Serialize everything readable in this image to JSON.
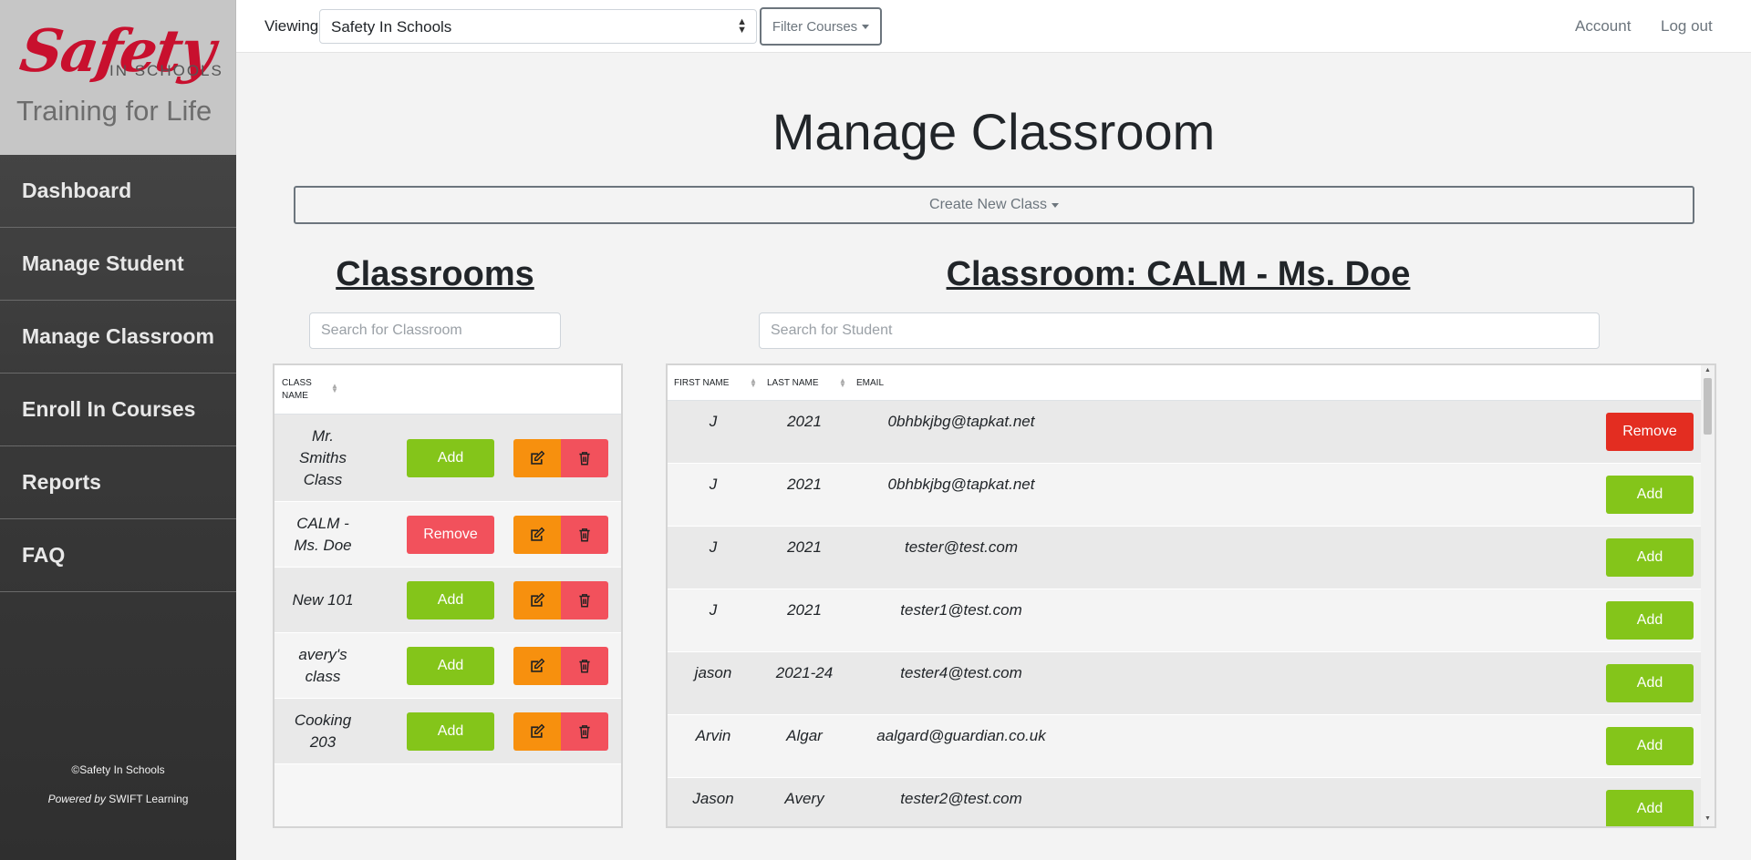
{
  "sidebar": {
    "logo_main": "Safety",
    "logo_sub": "IN SCHOOLS",
    "logo_tagline": "Training for Life",
    "items": [
      {
        "label": "Dashboard"
      },
      {
        "label": "Manage Student"
      },
      {
        "label": "Manage Classroom"
      },
      {
        "label": "Enroll In Courses"
      },
      {
        "label": "Reports"
      },
      {
        "label": "FAQ"
      }
    ],
    "copyright": "©Safety In Schools",
    "powered_prefix": "Powered by",
    "powered_brand": "SWIFT Learning"
  },
  "topbar": {
    "viewing_label": "Viewing:",
    "viewing_value": "Safety In Schools",
    "filter_label": "Filter Courses",
    "account_label": "Account",
    "logout_label": "Log out"
  },
  "main": {
    "title": "Manage Classroom",
    "create_label": "Create New Class",
    "classrooms_title": "Classrooms",
    "classroom_detail_title": "Classroom: CALM - Ms. Doe",
    "class_search_placeholder": "Search for Classroom",
    "student_search_placeholder": "Search for Student"
  },
  "class_table": {
    "header": "CLASS NAME",
    "rows": [
      {
        "name": "Mr. Smiths Class",
        "action": "Add"
      },
      {
        "name": "CALM - Ms. Doe",
        "action": "Remove"
      },
      {
        "name": "New 101",
        "action": "Add"
      },
      {
        "name": "avery's class",
        "action": "Add"
      },
      {
        "name": "Cooking 203",
        "action": "Add"
      }
    ]
  },
  "student_table": {
    "headers": {
      "first": "FIRST NAME",
      "last": "LAST NAME",
      "email": "EMAIL"
    },
    "rows": [
      {
        "first": "J",
        "last": "2021",
        "email": "0bhbkjbg@tapkat.net",
        "action": "Remove"
      },
      {
        "first": "J",
        "last": "2021",
        "email": "0bhbkjbg@tapkat.net",
        "action": "Add"
      },
      {
        "first": "J",
        "last": "2021",
        "email": "tester@test.com",
        "action": "Add"
      },
      {
        "first": "J",
        "last": "2021",
        "email": "tester1@test.com",
        "action": "Add"
      },
      {
        "first": "jason",
        "last": "2021-24",
        "email": "tester4@test.com",
        "action": "Add"
      },
      {
        "first": "Arvin",
        "last": "Algar",
        "email": "aalgard@guardian.co.uk",
        "action": "Add"
      },
      {
        "first": "Jason",
        "last": "Avery",
        "email": "tester2@test.com",
        "action": "Add"
      }
    ]
  },
  "colors": {
    "add": "#84c51a",
    "remove_class": "#f2515c",
    "remove_student": "#e32d21",
    "edit": "#f7900e",
    "delete": "#f2515c",
    "brand_red": "#c8102e"
  },
  "icons": {
    "edit": "edit-icon",
    "delete": "trash-icon",
    "sort": "sort-icon",
    "select": "select-arrows-icon"
  }
}
